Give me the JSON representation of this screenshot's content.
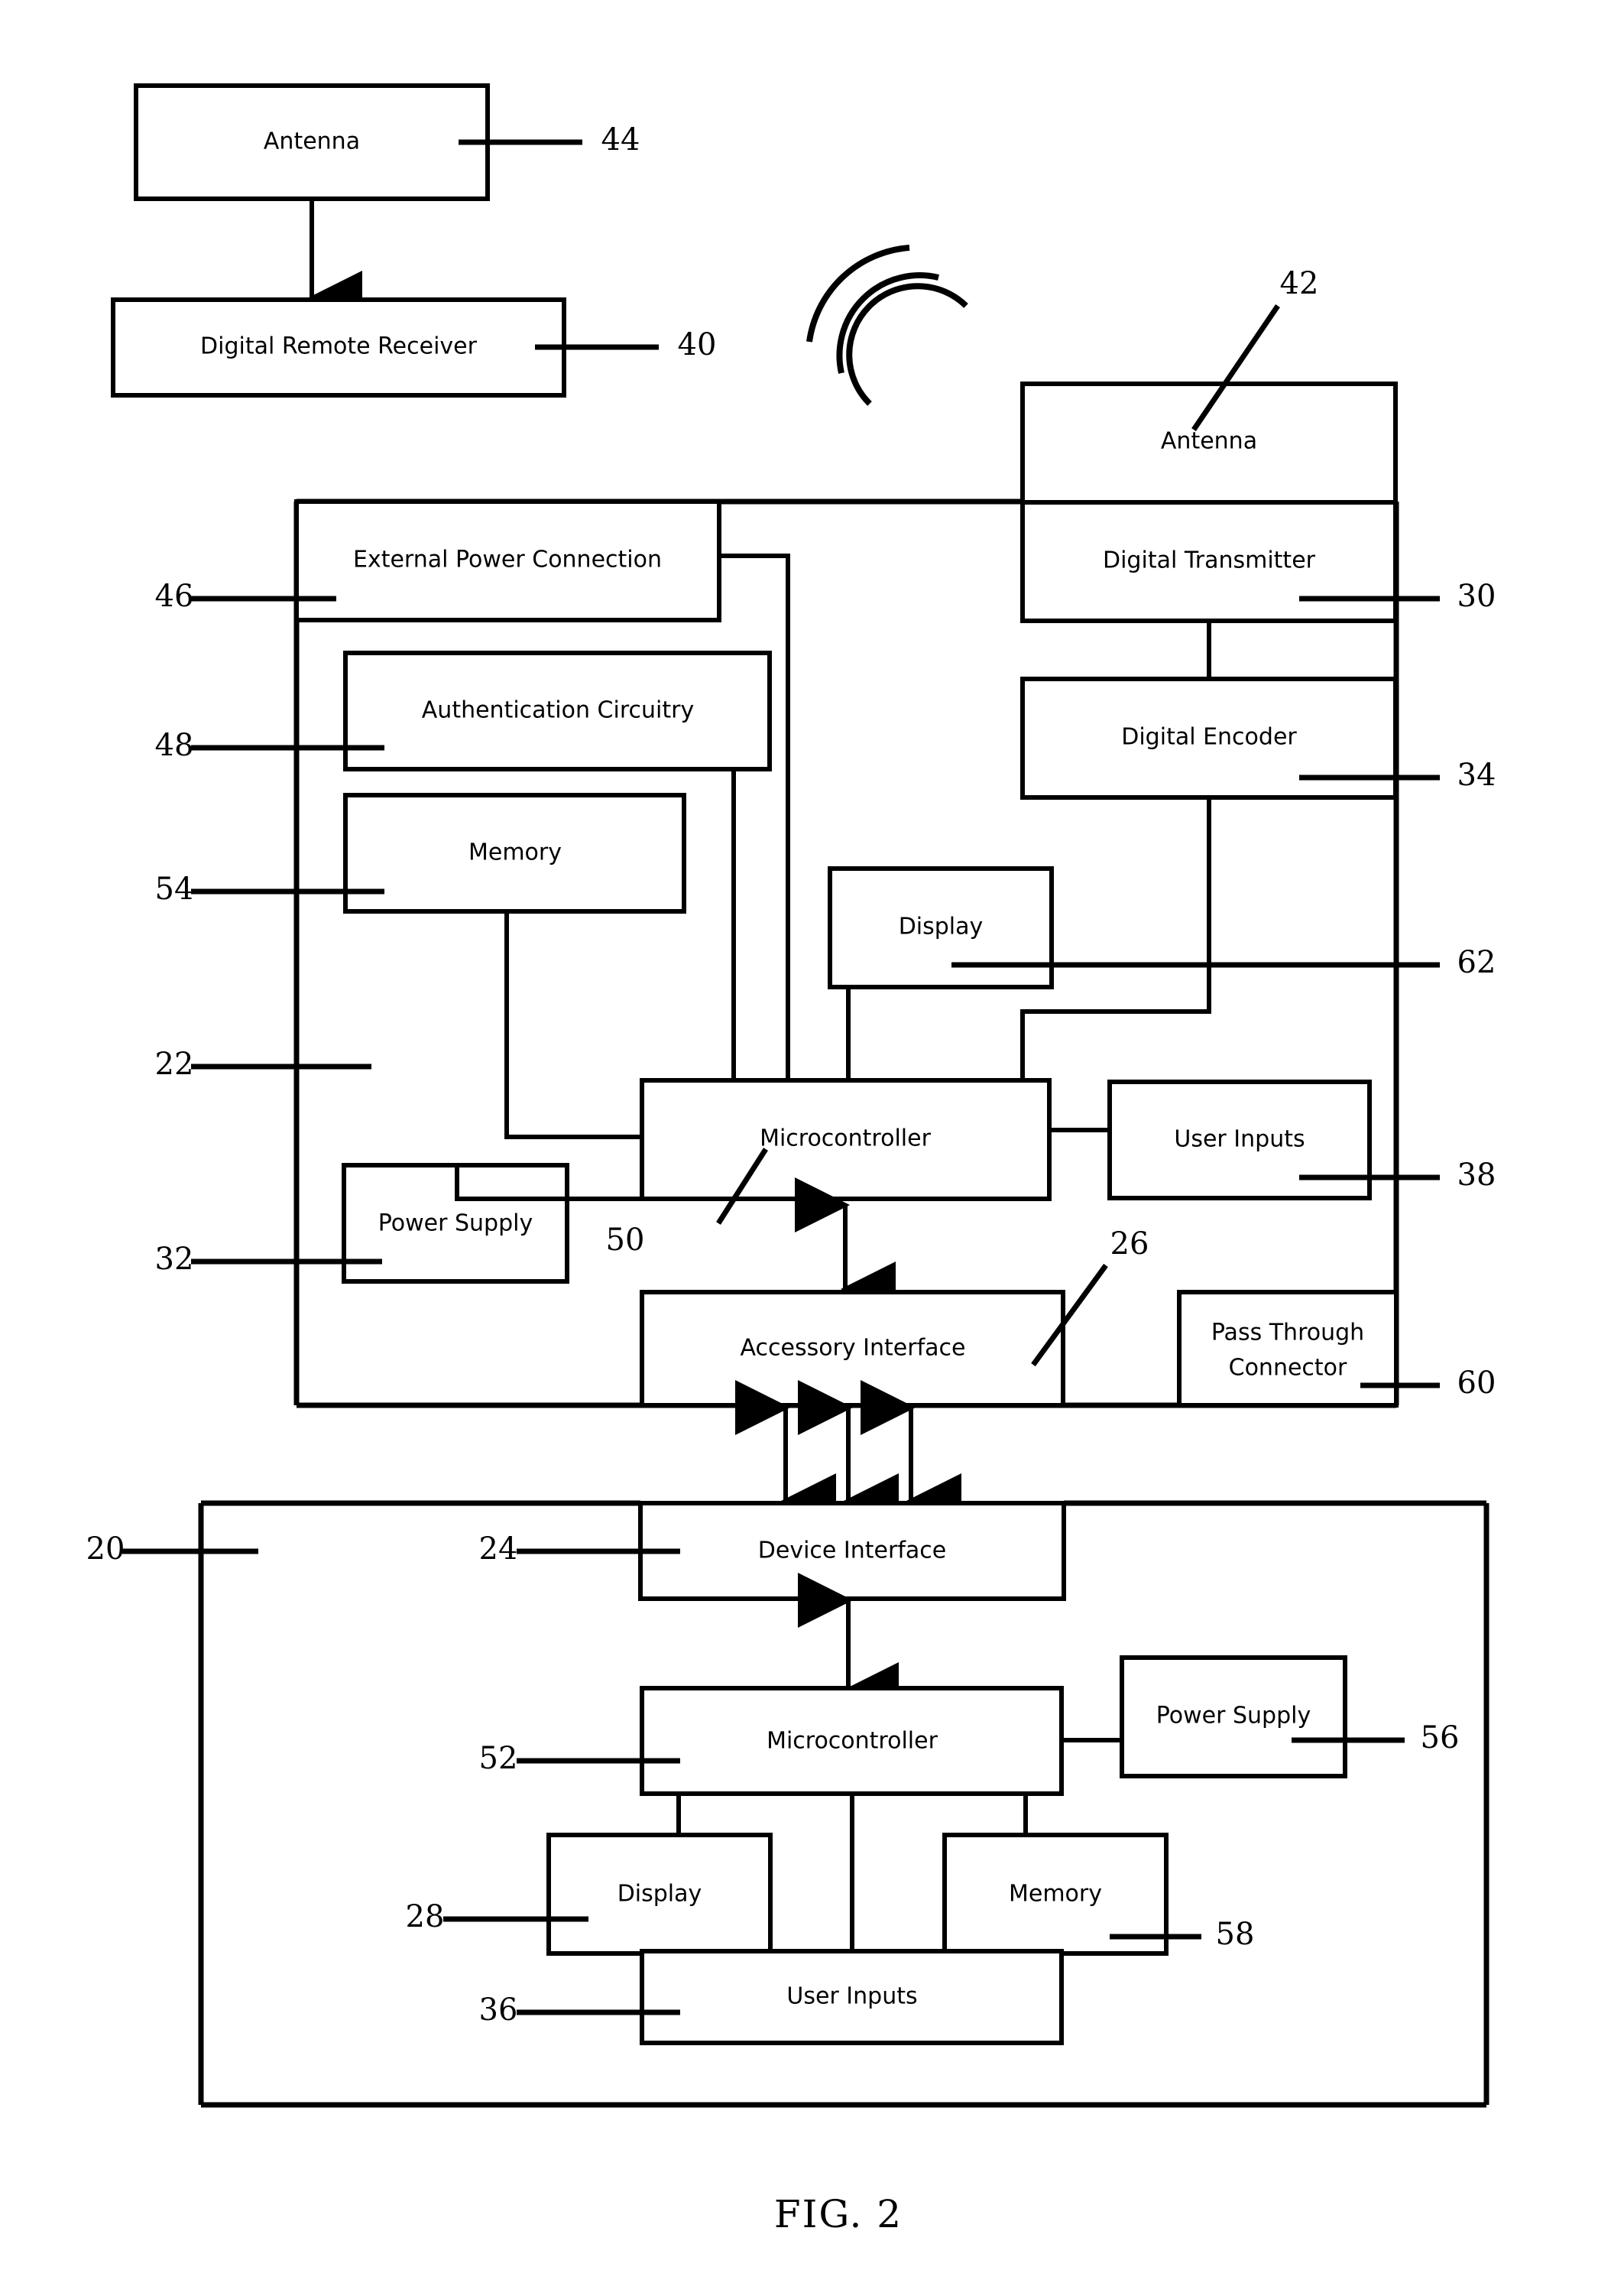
{
  "figure": {
    "caption": "FIG. 2",
    "background_color": "#ffffff",
    "line_color": "#000000"
  },
  "remote_group": {
    "antenna": {
      "label": "Antenna",
      "ref": "44"
    },
    "receiver": {
      "label": "Digital Remote Receiver",
      "ref": "40"
    }
  },
  "accessory": {
    "ref": "22",
    "blocks": {
      "antenna": {
        "label": "Antenna",
        "ref": "42"
      },
      "digital_transmitter": {
        "label": "Digital Transmitter",
        "ref": "30"
      },
      "digital_encoder": {
        "label": "Digital Encoder",
        "ref": "34"
      },
      "external_power_connection": {
        "label": "External Power Connection",
        "ref": "46"
      },
      "authentication_circuitry": {
        "label": "Authentication Circuitry",
        "ref": "48"
      },
      "memory": {
        "label": "Memory",
        "ref": "54"
      },
      "display": {
        "label": "Display",
        "ref": "62"
      },
      "microcontroller": {
        "label": "Microcontroller",
        "ref": "50"
      },
      "user_inputs": {
        "label": "User Inputs",
        "ref": "38"
      },
      "power_supply": {
        "label": "Power Supply",
        "ref": "32"
      },
      "accessory_interface": {
        "label": "Accessory Interface",
        "ref": "26"
      },
      "pass_through_connector": {
        "label": "Pass Through\nConnector",
        "label_line1": "Pass Through",
        "label_line2": "Connector",
        "ref": "60"
      }
    }
  },
  "device": {
    "ref": "20",
    "blocks": {
      "device_interface": {
        "label": "Device Interface",
        "ref": "24"
      },
      "microcontroller": {
        "label": "Microcontroller",
        "ref": "52"
      },
      "power_supply": {
        "label": "Power Supply",
        "ref": "56"
      },
      "display": {
        "label": "Display",
        "ref": "28"
      },
      "memory": {
        "label": "Memory",
        "ref": "58"
      },
      "user_inputs": {
        "label": "User Inputs",
        "ref": "36"
      }
    }
  },
  "signal_waves": {
    "name": "wireless-signal-arcs",
    "arc_count": 3
  }
}
